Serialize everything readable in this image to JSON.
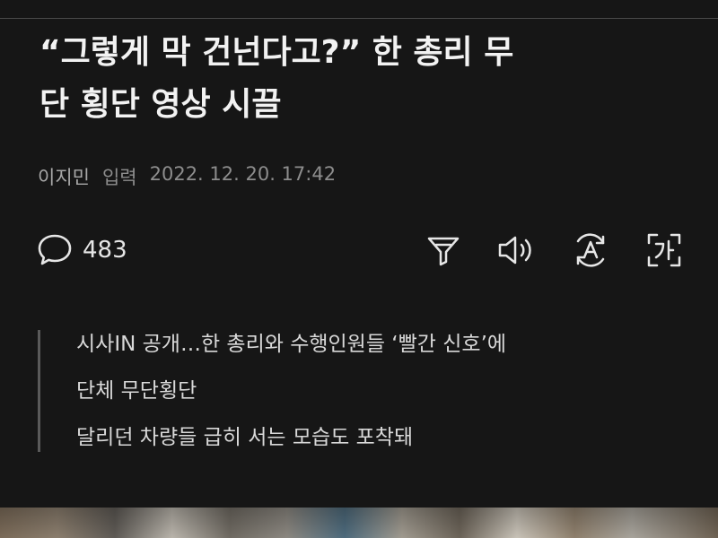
{
  "article": {
    "headline_line1": "“그렇게 막 건넌다고?” 한 총리 무",
    "headline_line2": "단 횡단 영상 시끌",
    "author": "이지민",
    "input_label": "입력",
    "datetime": "2022. 12. 20. 17:42"
  },
  "toolbar": {
    "comment_count": "483",
    "icons": [
      "comment-icon",
      "filter-icon",
      "speaker-icon",
      "translate-icon",
      "font-size-icon"
    ]
  },
  "summary": {
    "lines": [
      "시사IN 공개…한 총리와 수행인원들 ‘빨간 신호’에",
      "단체 무단횡단",
      "달리던 차량들 급히 서는 모습도 포착돼"
    ]
  },
  "colors": {
    "background": "#161616",
    "headline": "#f2f2f2",
    "muted": "#8d8d8d",
    "icon": "#e6e6e6"
  }
}
